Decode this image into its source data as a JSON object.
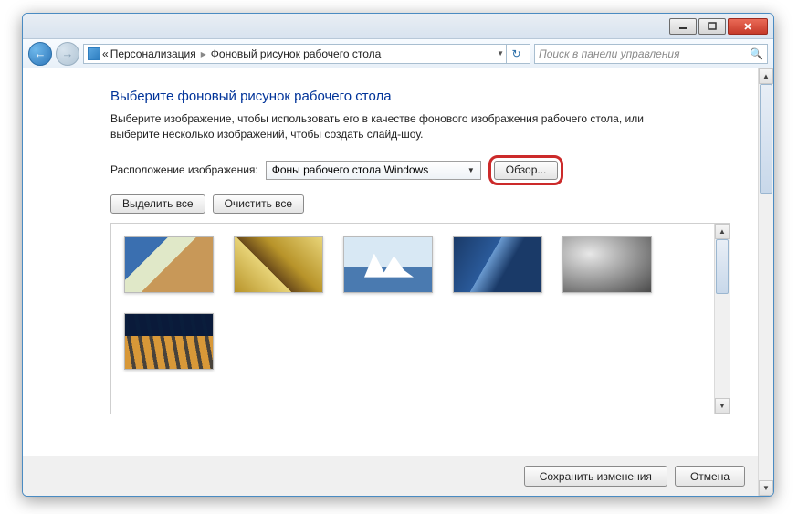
{
  "breadcrumb": {
    "laquo": "«",
    "seg1": "Персонализация",
    "seg2": "Фоновый рисунок рабочего стола"
  },
  "search": {
    "placeholder": "Поиск в панели управления"
  },
  "heading": "Выберите фоновый рисунок рабочего стола",
  "subtext": "Выберите изображение, чтобы использовать его в качестве фонового изображения рабочего стола, или выберите несколько изображений, чтобы создать слайд-шоу.",
  "location_label": "Расположение изображения:",
  "dropdown_value": "Фоны рабочего стола Windows",
  "browse_label": "Обзор...",
  "select_all": "Выделить все",
  "clear_all": "Очистить все",
  "save": "Сохранить изменения",
  "cancel": "Отмена"
}
